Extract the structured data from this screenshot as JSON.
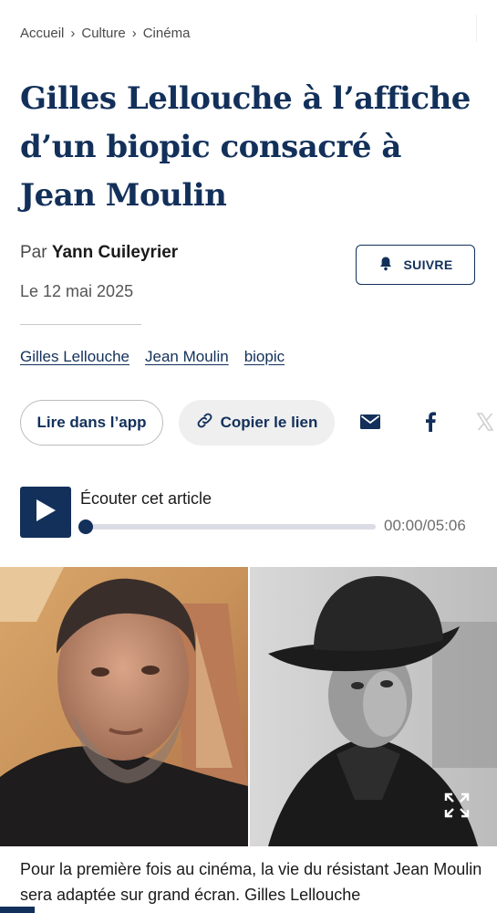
{
  "breadcrumb": {
    "items": [
      "Accueil",
      "Culture",
      "Cinéma"
    ]
  },
  "article": {
    "title": "Gilles Lellouche à l’affiche d’un biopic consacré à Jean Moulin",
    "byline_prefix": "Par",
    "author": "Yann Cuileyrier",
    "date": "Le 12 mai 2025",
    "lede": "Pour la première fois au cinéma, la vie du résistant Jean Moulin sera adaptée sur grand écran. Gilles Lellouche"
  },
  "follow": {
    "label": "SUIVRE",
    "icon": "bell-icon"
  },
  "tags": [
    "Gilles Lellouche",
    "Jean Moulin",
    "biopic"
  ],
  "actions": {
    "app_label": "Lire dans l’app",
    "copy_label": "Copier le lien",
    "copy_icon": "link-icon",
    "share_icons": [
      "mail-icon",
      "facebook-icon",
      "x-icon"
    ]
  },
  "audio": {
    "label": "Écouter cet article",
    "time": "00:00/05:06",
    "progress": 0,
    "icon": "play-icon"
  },
  "hero": {
    "expand_icon": "expand-icon"
  },
  "colors": {
    "brand": "#12305a",
    "text": "#1a1a1a",
    "muted": "#4a4a4a"
  }
}
